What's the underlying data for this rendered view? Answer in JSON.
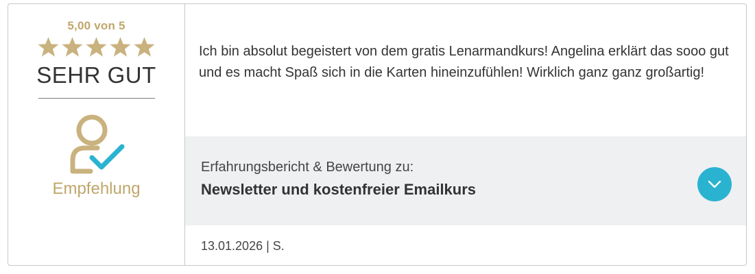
{
  "rating": {
    "score_text": "5,00 von 5",
    "stars": 5,
    "stars_max": 5,
    "verdict": "SEHR GUT",
    "recommendation_label": "Empfehlung",
    "icon": "user-check-icon"
  },
  "review": {
    "text": "Ich bin absolut begeistert von dem gratis Lenarmandkurs! Angelina erklärt das sooo gut und es macht Spaß sich in die Karten hineinzufühlen! Wirklich ganz ganz großartig!"
  },
  "product": {
    "caption": "Erfahrungsbericht & Bewertung zu:",
    "name": "Newsletter und kostenfreier Emailkurs",
    "toggle_icon": "chevron-down-icon"
  },
  "meta": {
    "date_author": "13.01.2026 | S."
  },
  "colors": {
    "gold": "#bfa76a",
    "accent": "#2ab3d1",
    "panel_bg": "#eef0f2",
    "text": "#333333"
  }
}
